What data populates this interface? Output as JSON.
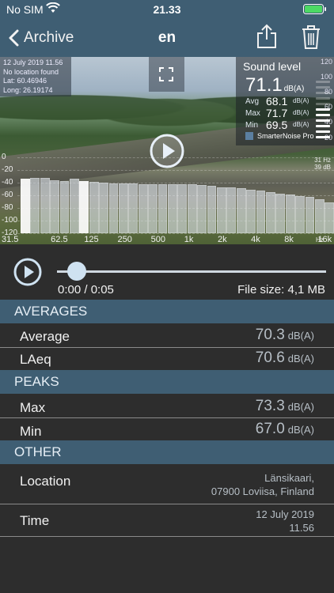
{
  "status_bar": {
    "carrier": "No SIM",
    "time": "21.33"
  },
  "nav": {
    "back_label": "Archive",
    "title": "en"
  },
  "photo_overlay": {
    "info_lines": [
      "12 July 2019 11.56",
      "No location found",
      "Lat: 60.46946",
      "Long: 26.19174"
    ],
    "sound_level": {
      "label": "Sound level",
      "value": "71.1",
      "unit": "dB(A)",
      "stats": [
        {
          "label": "Avg",
          "value": "68.1",
          "unit": "dB(A)"
        },
        {
          "label": "Max",
          "value": "71.7",
          "unit": "dB(A)"
        },
        {
          "label": "Min",
          "value": "69.5",
          "unit": "dB(A)"
        }
      ],
      "scale_ticks": [
        "120",
        "100",
        "80",
        "60",
        "40",
        "20"
      ],
      "meter_level_fraction": 0.55,
      "brand": "SmarterNoise Pro"
    }
  },
  "spectrum": {
    "y_ticks": [
      "0",
      "-20",
      "-40",
      "-60",
      "-80",
      "-100",
      "-120"
    ],
    "x_labels": [
      "31.5",
      "62.5",
      "125",
      "250",
      "500",
      "1k",
      "2k",
      "4k",
      "8k",
      "16k"
    ],
    "unit": "Hz",
    "selected_readout": [
      "31 Hz",
      "39 dB"
    ],
    "band_levels_db": [
      -34,
      -33,
      -33,
      -36,
      -37,
      -34,
      -38,
      -39,
      -40,
      -41,
      -41,
      -41,
      -42,
      -42,
      -42,
      -42,
      -43,
      -43,
      -44,
      -45,
      -47,
      -48,
      -49,
      -51,
      -53,
      -55,
      -57,
      -59,
      -61,
      -63,
      -66,
      -71
    ],
    "highlighted_bands": [
      0,
      6
    ]
  },
  "player": {
    "time": "0:00 / 0:05",
    "file_size": "File size: 4,1 MB",
    "progress_fraction": 0.05
  },
  "sections": {
    "averages": {
      "title": "AVERAGES",
      "rows": [
        {
          "label": "Average",
          "value": "70.3",
          "unit": "dB(A)"
        },
        {
          "label": "LAeq",
          "value": "70.6",
          "unit": "dB(A)"
        }
      ]
    },
    "peaks": {
      "title": "PEAKS",
      "rows": [
        {
          "label": "Max",
          "value": "73.3",
          "unit": "dB(A)"
        },
        {
          "label": "Min",
          "value": "67.0",
          "unit": "dB(A)"
        }
      ]
    },
    "other": {
      "title": "OTHER",
      "location": {
        "label": "Location",
        "lines": [
          "Länsikaari,",
          "07900 Loviisa, Finland"
        ]
      },
      "time": {
        "label": "Time",
        "lines": [
          "12 July 2019",
          "11.56"
        ]
      }
    }
  }
}
